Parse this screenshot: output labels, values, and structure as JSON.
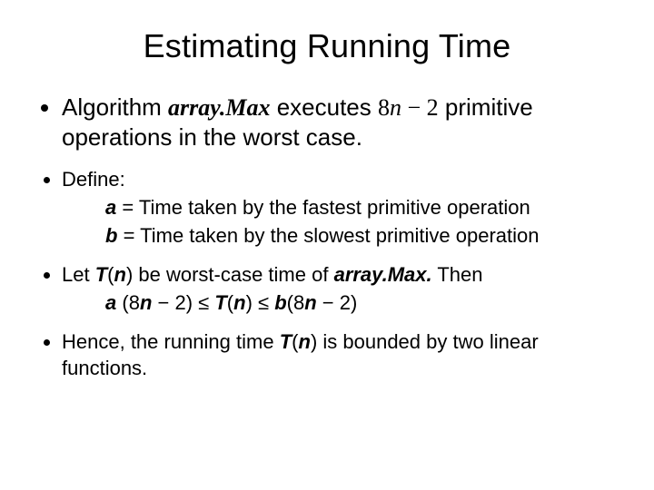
{
  "title": "Estimating Running Time",
  "b1": {
    "pre": "Algorithm ",
    "alg": "array.Max",
    "mid": " executes ",
    "expr_n": "n",
    "post": " primitive operations in the worst case."
  },
  "b2": {
    "define": "Define:",
    "a_lbl": "a",
    "a_txt": " = Time taken by the fastest primitive operation",
    "b_lbl": "b",
    "b_txt": " = Time taken by the slowest primitive operation"
  },
  "b3": {
    "pre": "Let ",
    "T": "T",
    "n": "n",
    "mid1": ") be worst-case time of ",
    "alg": "array.Max.",
    "post": " Then",
    "ineq_a": "a",
    "ineq_mid1": " (8",
    "ineq_n1": "n",
    "ineq_mid2": " − 2) ≤ ",
    "ineq_T1": "T",
    "ineq_paren_open": "(",
    "ineq_n2": "n",
    "ineq_mid3": ") ≤ ",
    "ineq_b": "b",
    "ineq_mid4": "(8",
    "ineq_n3": "n",
    "ineq_end": " − 2)"
  },
  "b4": {
    "pre": "Hence, the running time ",
    "T": "T",
    "n": "n",
    "post": ") is bounded by two linear functions."
  }
}
